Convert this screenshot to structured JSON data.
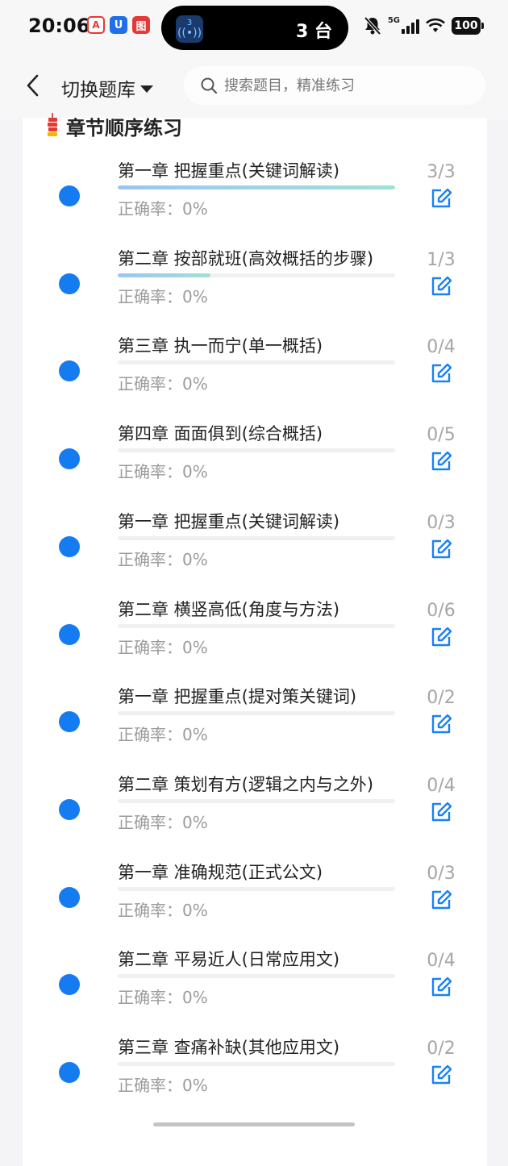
{
  "status_bar": {
    "time": "20:06",
    "app_icons": [
      "A",
      "U",
      "图"
    ],
    "island_count": "3 台",
    "island_badge": "3",
    "network": "5G",
    "battery": "100"
  },
  "header": {
    "switch_label": "切换题库",
    "search_placeholder": "搜索题目，精准练习"
  },
  "section": {
    "title": "章节顺序练习"
  },
  "chapters": [
    {
      "title": "第一章 把握重点(关键词解读)",
      "accuracy": "正确率：0%",
      "count": "3/3",
      "progress": 1.0
    },
    {
      "title": "第二章 按部就班(高效概括的步骤)",
      "accuracy": "正确率：0%",
      "count": "1/3",
      "progress": 0.333
    },
    {
      "title": "第三章 执一而宁(单一概括)",
      "accuracy": "正确率：0%",
      "count": "0/4",
      "progress": 0
    },
    {
      "title": "第四章 面面俱到(综合概括)",
      "accuracy": "正确率：0%",
      "count": "0/5",
      "progress": 0
    },
    {
      "title": "第一章 把握重点(关键词解读)",
      "accuracy": "正确率：0%",
      "count": "0/3",
      "progress": 0
    },
    {
      "title": "第二章 横竖高低(角度与方法)",
      "accuracy": "正确率：0%",
      "count": "0/6",
      "progress": 0
    },
    {
      "title": "第一章 把握重点(提对策关键词)",
      "accuracy": "正确率：0%",
      "count": "0/2",
      "progress": 0
    },
    {
      "title": "第二章 策划有方(逻辑之内与之外)",
      "accuracy": "正确率：0%",
      "count": "0/4",
      "progress": 0
    },
    {
      "title": "第一章 准确规范(正式公文)",
      "accuracy": "正确率：0%",
      "count": "0/3",
      "progress": 0
    },
    {
      "title": "第二章 平易近人(日常应用文)",
      "accuracy": "正确率：0%",
      "count": "0/4",
      "progress": 0
    },
    {
      "title": "第三章 查痛补缺(其他应用文)",
      "accuracy": "正确率：0%",
      "count": "0/2",
      "progress": 0
    }
  ],
  "colors": {
    "dot": "#157bf1",
    "edit_icon": "#1a82f4",
    "count": "#a6a6a6"
  }
}
